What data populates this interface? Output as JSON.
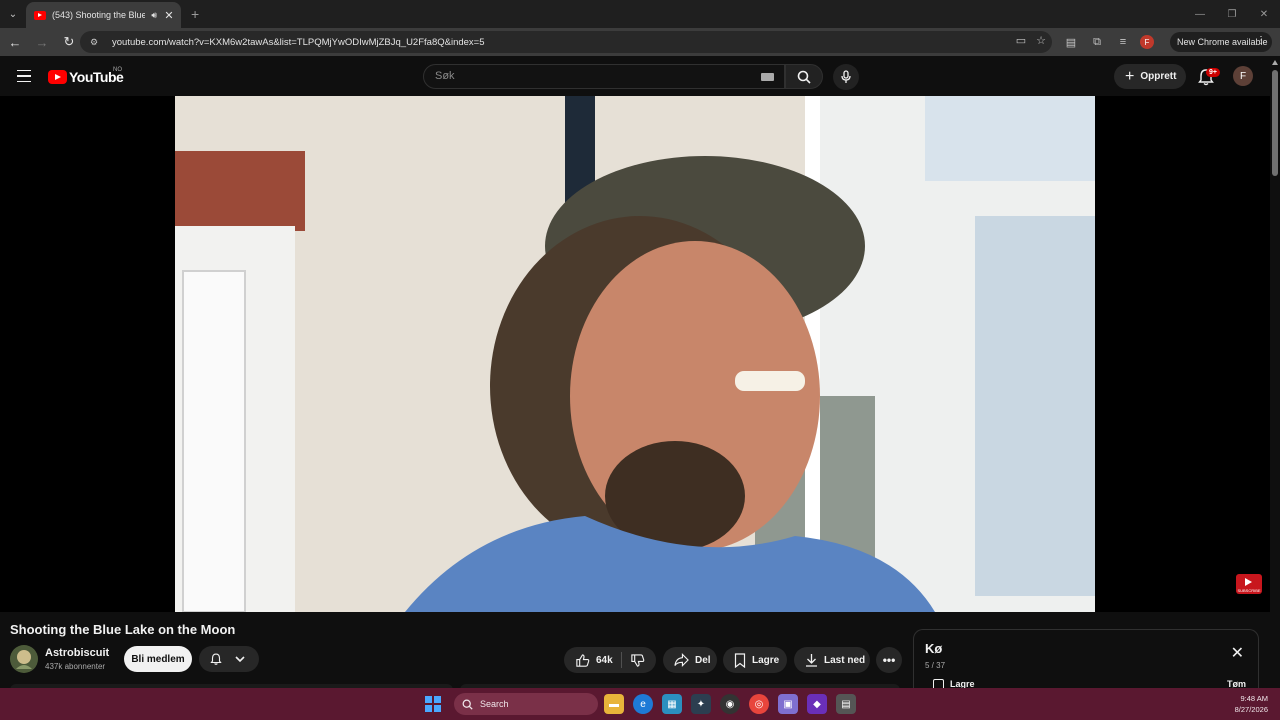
{
  "browser": {
    "tab_title": "(543) Shooting the Blue Lake on the Moon",
    "url": "youtube.com/watch?v=KXM6w2tawAs&list=TLPQMjYwODIwMjZBJq_U2Ffa8Q&index=5",
    "profile_initial": "F",
    "new_chrome_label": "New Chrome available"
  },
  "youtube": {
    "logo_text": "YouTube",
    "country_code": "NO",
    "search_placeholder": "Søk",
    "create_label": "Opprett",
    "notification_badge": "9+",
    "avatar_initial": "F"
  },
  "video": {
    "title": "Shooting the Blue Lake on the Moon",
    "channel_name": "Astrobiscuit",
    "subscribers": "437k abonnenter",
    "join_label": "Bli medlem",
    "likes": "64k",
    "share_label": "Del",
    "save_label": "Lagre",
    "download_label": "Last ned",
    "watermark_text": "SUBSCRIBE"
  },
  "queue": {
    "title": "Kø",
    "position": "5 / 37",
    "save_label": "Lagre",
    "clear_label": "Tøm"
  },
  "taskbar": {
    "search_label": "Search",
    "time": "9:48 AM",
    "date": "8/27/2026"
  },
  "colors": {
    "youtube_red": "#ff0000",
    "taskbar": "#5a1830",
    "background": "#0f0f0f"
  }
}
